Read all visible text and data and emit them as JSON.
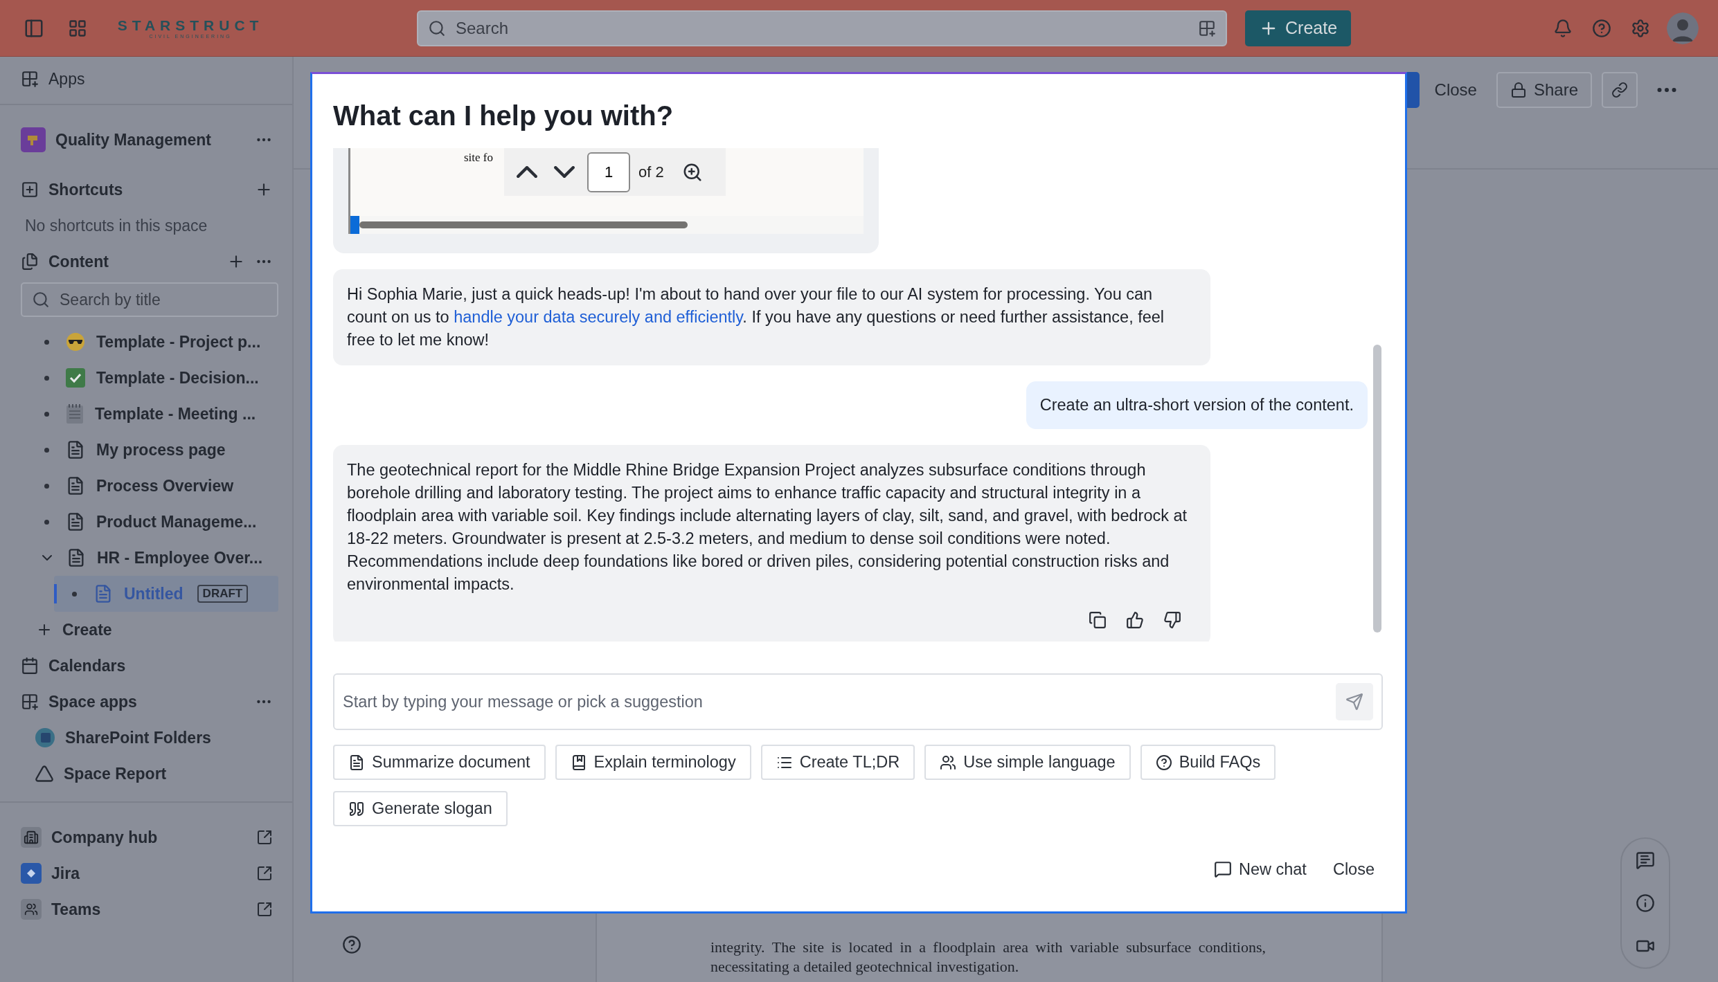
{
  "top_bar": {
    "logo": "STARSTRUCT",
    "logo_subtitle": "CIVIL ENGINEERING",
    "search": {
      "placeholder": "Search"
    },
    "create_button": "Create"
  },
  "sidebar": {
    "apps": "Apps",
    "space": "Quality Management",
    "shortcuts": {
      "title": "Shortcuts",
      "empty": "No shortcuts in this space"
    },
    "content": {
      "title": "Content",
      "search": {
        "placeholder": "Search by title"
      },
      "tree": [
        {
          "label": "Template - Project p...",
          "expanded": false,
          "selected": false
        },
        {
          "label": "Template - Decision...",
          "expanded": false,
          "selected": false
        },
        {
          "label": "Template - Meeting ...",
          "expanded": false,
          "selected": false
        },
        {
          "label": "My process page",
          "expanded": false,
          "selected": false
        },
        {
          "label": "Process Overview",
          "expanded": false,
          "selected": false
        },
        {
          "label": "Product Manageme...",
          "expanded": false,
          "selected": false
        },
        {
          "label": "HR - Employee Over...",
          "expanded": true,
          "selected": false,
          "children": [
            {
              "label": "Untitled",
              "badge": "DRAFT",
              "expanded": false,
              "selected": true
            }
          ]
        }
      ],
      "create": "Create"
    },
    "calendars": "Calendars",
    "space_apps": {
      "title": "Space apps",
      "items": [
        "SharePoint Folders",
        "Space Report"
      ]
    },
    "links": [
      "Company hub",
      "Jira",
      "Teams"
    ]
  },
  "page_header": {
    "close": "Close",
    "share": "Share"
  },
  "document": {
    "lines": [
      "integrity. The site is located in a floodplain area with variable subsurface conditions,",
      "necessitating a detailed geotechnical investigation."
    ]
  },
  "modal": {
    "title": "What can I help you with?",
    "messages": [
      {
        "kind": "document_preview",
        "preview_text": "site fo",
        "page": "1",
        "page_count": "of 2"
      },
      {
        "kind": "assistant",
        "feedback": false,
        "parts": [
          {
            "text": "Hi Sophia Marie, just a quick heads-up! I'm about to hand over your file to our AI system for processing. You can count on us to "
          },
          {
            "link": "handle your data securely and efficiently"
          },
          {
            "text": ". If you have any questions or need further assistance, feel free to let me know!"
          }
        ]
      },
      {
        "kind": "user",
        "parts": [
          {
            "text": "Create an ultra-short version of the content."
          }
        ]
      },
      {
        "kind": "assistant",
        "feedback": true,
        "parts": [
          {
            "text": "The geotechnical report for the Middle Rhine Bridge Expansion Project analyzes subsurface conditions through borehole drilling and laboratory testing. The project aims to enhance traffic capacity and structural integrity in a floodplain area with variable soil. Key findings include alternating layers of clay, silt, sand, and gravel, with bedrock at 18-22 meters. Groundwater is present at 2.5-3.2 meters, and medium to dense soil conditions were noted. Recommendations include deep foundations like bored or driven piles, considering potential construction risks and environmental impacts."
          }
        ]
      }
    ],
    "input": {
      "placeholder": "Start by typing your message or pick a suggestion"
    },
    "suggestions": [
      "Summarize document",
      "Explain terminology",
      "Create TL;DR",
      "Use simple language",
      "Build FAQs",
      "Generate slogan"
    ],
    "new_chat": "New chat",
    "close": "Close"
  }
}
